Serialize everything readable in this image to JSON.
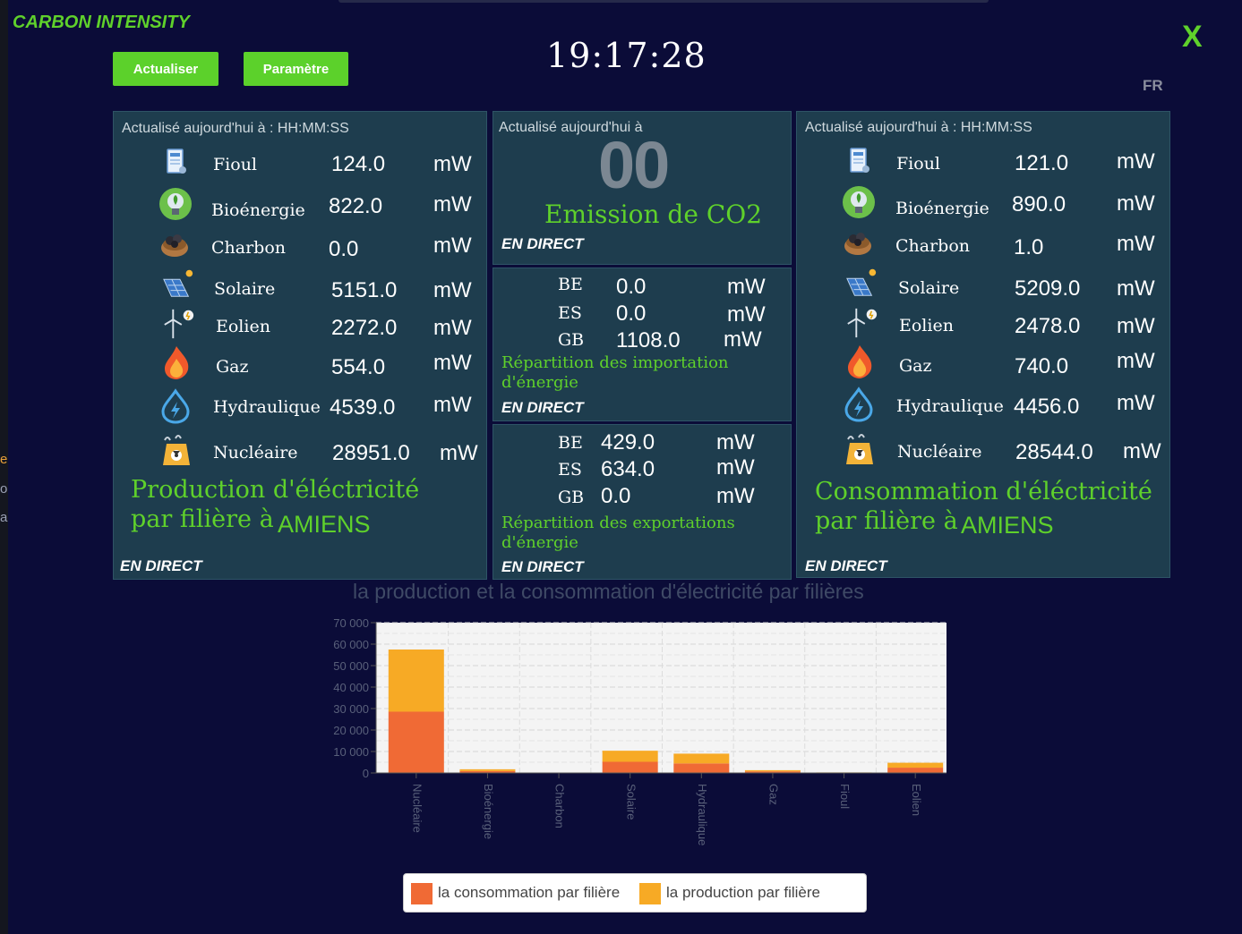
{
  "app": {
    "title": "CARBON INTENSITY",
    "clock": "19:17:28",
    "lang": "FR",
    "close": "X"
  },
  "buttons": {
    "refresh": "Actualiser",
    "settings": "Paramètre"
  },
  "stray": [
    "e.",
    "o",
    "a"
  ],
  "production": {
    "updated": "Actualisé aujourd'hui à :   HH:MM:SS",
    "sources": [
      {
        "name": "Fioul",
        "value": "124.0",
        "unit": "mW"
      },
      {
        "name": "Bioénergie",
        "value": "822.0",
        "unit": "mW"
      },
      {
        "name": "Charbon",
        "value": "0.0",
        "unit": "mW"
      },
      {
        "name": "Solaire",
        "value": "5151.0",
        "unit": "mW"
      },
      {
        "name": "Eolien",
        "value": "2272.0",
        "unit": "mW"
      },
      {
        "name": "Gaz",
        "value": "554.0",
        "unit": "mW"
      },
      {
        "name": "Hydraulique",
        "value": "4539.0",
        "unit": "mW"
      },
      {
        "name": "Nucléaire",
        "value": "28951.0",
        "unit": "mW"
      }
    ],
    "caption_line1": "Production d'éléctricité",
    "caption_line2": "par filière à",
    "city": "AMIENS",
    "live": "EN DIRECT"
  },
  "consumption": {
    "updated": "Actualisé aujourd'hui à :   HH:MM:SS",
    "sources": [
      {
        "name": "Fioul",
        "value": "121.0",
        "unit": "mW"
      },
      {
        "name": "Bioénergie",
        "value": "890.0",
        "unit": "mW"
      },
      {
        "name": "Charbon",
        "value": "1.0",
        "unit": "mW"
      },
      {
        "name": "Solaire",
        "value": "5209.0",
        "unit": "mW"
      },
      {
        "name": "Eolien",
        "value": "2478.0",
        "unit": "mW"
      },
      {
        "name": "Gaz",
        "value": "740.0",
        "unit": "mW"
      },
      {
        "name": "Hydraulique",
        "value": "4456.0",
        "unit": "mW"
      },
      {
        "name": "Nucléaire",
        "value": "28544.0",
        "unit": "mW"
      }
    ],
    "caption_line1": "Consommation d'éléctricité",
    "caption_line2": "par filière à",
    "city": "AMIENS",
    "live": "EN DIRECT"
  },
  "emission": {
    "updated": "Actualisé aujourd'hui à",
    "value": "00",
    "label": "Emission de CO2",
    "live": "EN DIRECT"
  },
  "imports": {
    "rows": [
      {
        "country": "BE",
        "value": "0.0",
        "unit": "mW"
      },
      {
        "country": "ES",
        "value": "0.0",
        "unit": "mW"
      },
      {
        "country": "GB",
        "value": "1108.0",
        "unit": "mW"
      }
    ],
    "caption": "Répartition des importation",
    "caption2": "d'énergie",
    "live": "EN DIRECT"
  },
  "exports": {
    "rows": [
      {
        "country": "BE",
        "value": "429.0",
        "unit": "mW"
      },
      {
        "country": "ES",
        "value": "634.0",
        "unit": "mW"
      },
      {
        "country": "GB",
        "value": "0.0",
        "unit": "mW"
      }
    ],
    "caption": "Répartition des exportations",
    "caption2": "d'énergie",
    "live": "EN DIRECT"
  },
  "chart_data": {
    "type": "bar",
    "stacked": true,
    "title": "la production et la consommation d'électricité par filières",
    "categories": [
      "Nucléaire",
      "Bioénergie",
      "Charbon",
      "Solaire",
      "Hydraulique",
      "Gaz",
      "Fioul",
      "Eolien"
    ],
    "series": [
      {
        "name": "la consommation par filière",
        "color": "#f06a35",
        "values": [
          28544,
          890,
          1,
          5209,
          4456,
          740,
          121,
          2478
        ]
      },
      {
        "name": "la production par filière",
        "color": "#f7aa25",
        "values": [
          28951,
          822,
          0,
          5151,
          4539,
          554,
          124,
          2272
        ]
      }
    ],
    "ylim": [
      0,
      70000
    ],
    "yticks": [
      "0",
      "10 000",
      "20 000",
      "30 000",
      "40 000",
      "50 000",
      "60 000",
      "70 000"
    ],
    "grid": true,
    "legend": "bottom"
  }
}
